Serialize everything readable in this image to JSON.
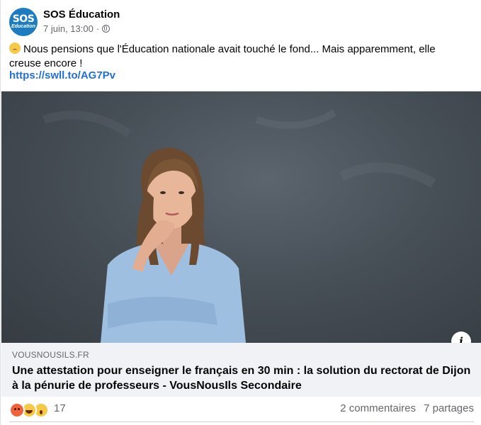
{
  "post": {
    "page_name": "SOS Éducation",
    "avatar_text_top": "SOS",
    "avatar_text_bottom": "Education",
    "timestamp": "7 juin, 13:00",
    "separator": "·",
    "audience_icon": "globe-icon",
    "message": "Nous pensions que l'Éducation nationale avait touché le fond... Mais apparemment, elle creuse encore !",
    "message_emoji": "worried-face-emoji",
    "link_text": "https://swll.to/AG7Pv"
  },
  "preview": {
    "domain": "VOUSNOUSILS.FR",
    "headline": "Une attestation pour enseigner le français en 30 min : la solution du rectorat de Dijon à la pénurie de professeurs - VousNousIls Secondaire",
    "info_label": "i"
  },
  "footer": {
    "reactions": [
      "angry-reaction-icon",
      "haha-reaction-icon",
      "wow-reaction-icon"
    ],
    "reaction_count": "17",
    "comments": "2 commentaires",
    "shares": "7 partages"
  },
  "colors": {
    "link": "#216fdb",
    "avatar": "#1b7cc2",
    "secondary_text": "#65676b",
    "preview_bg": "#f0f2f5"
  }
}
